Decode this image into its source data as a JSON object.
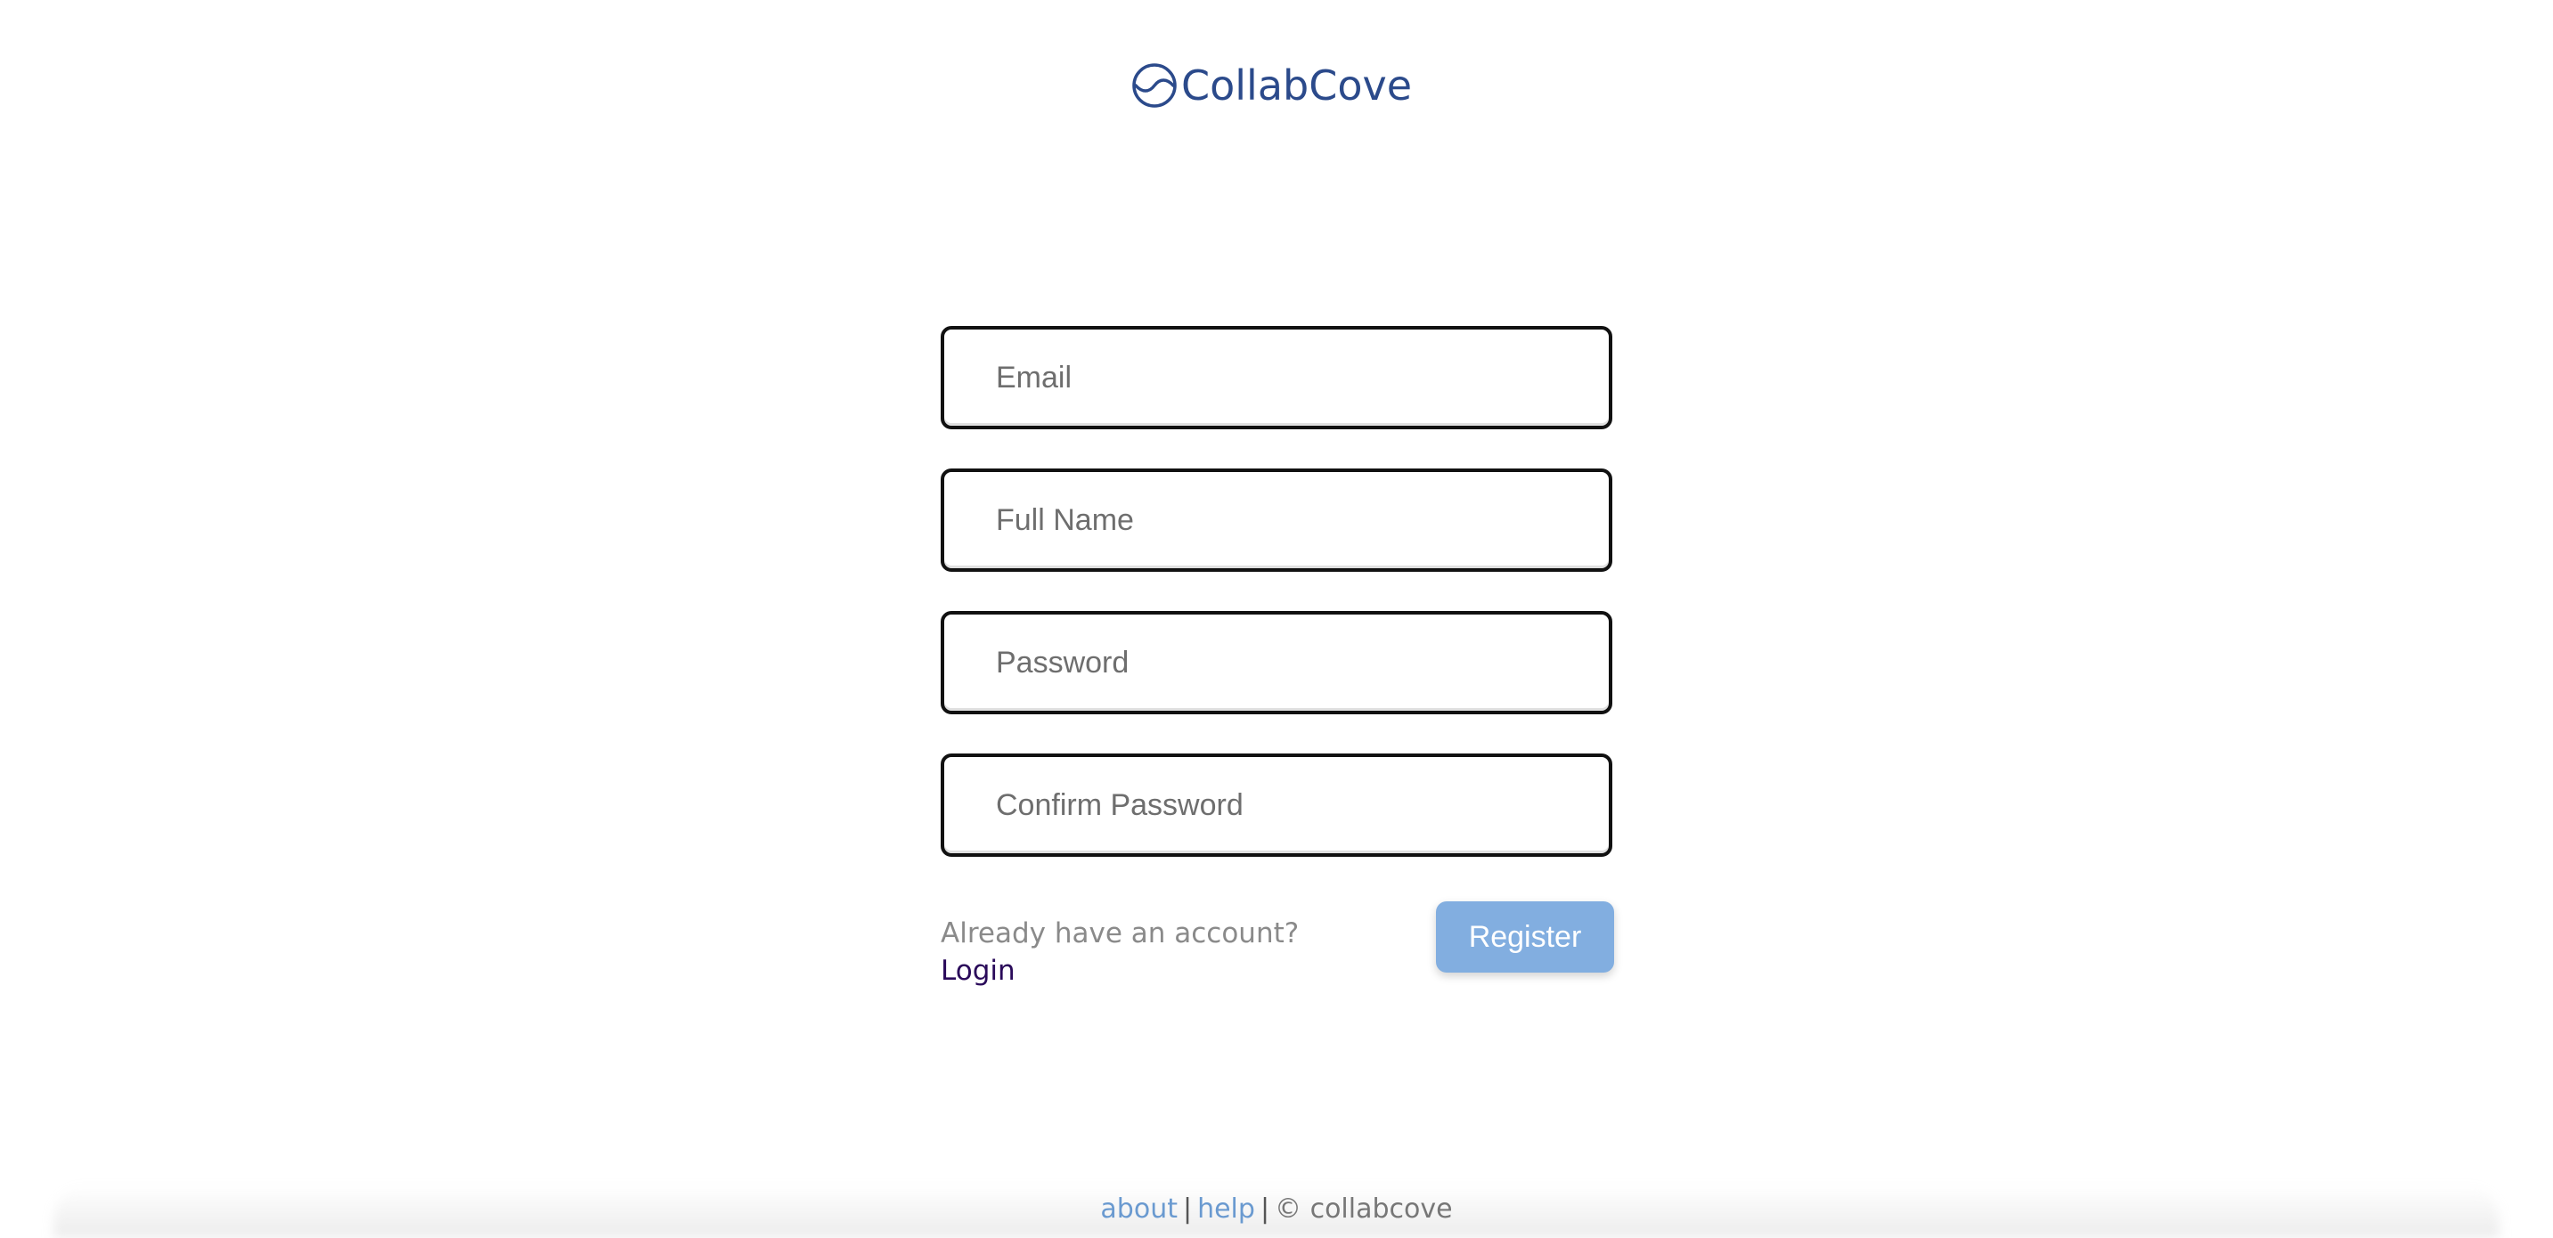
{
  "brand": {
    "name": "CollabCove",
    "icon": "collabcove-logo-icon",
    "color": "#2b4a8b"
  },
  "form": {
    "email_placeholder": "Email",
    "fullname_placeholder": "Full Name",
    "password_placeholder": "Password",
    "confirm_password_placeholder": "Confirm Password",
    "already_text": "Already have an account?",
    "login_label": "Login",
    "register_label": "Register",
    "register_color": "#82aee0"
  },
  "footer": {
    "about_label": "about",
    "separator": "|",
    "help_label": "help",
    "copyright": "© collabcove",
    "link_color": "#6a9ad0"
  }
}
